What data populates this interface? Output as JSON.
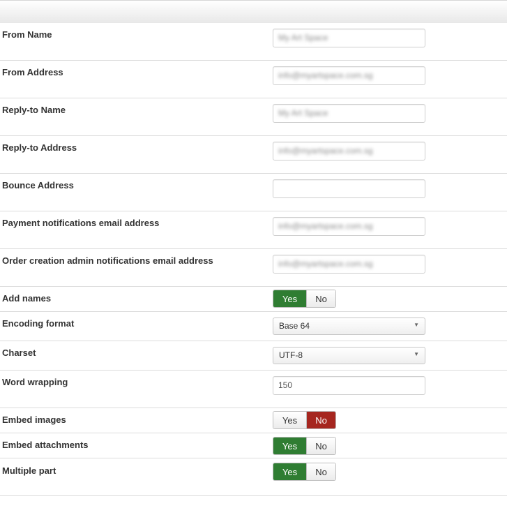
{
  "fields": {
    "from_name": {
      "label": "From Name",
      "value": "My Art Space"
    },
    "from_address": {
      "label": "From Address",
      "value": "info@myartspace.com.sg"
    },
    "replyto_name": {
      "label": "Reply-to Name",
      "value": "My Art Space"
    },
    "replyto_address": {
      "label": "Reply-to Address",
      "value": "info@myartspace.com.sg"
    },
    "bounce_address": {
      "label": "Bounce Address",
      "value": ""
    },
    "payment_notif": {
      "label": "Payment notifications email address",
      "value": "info@myartspace.com.sg"
    },
    "order_notif": {
      "label": "Order creation admin notifications email address",
      "value": "info@myartspace.com.sg"
    },
    "add_names": {
      "label": "Add names",
      "yes": "Yes",
      "no": "No",
      "selected": "Yes"
    },
    "encoding_format": {
      "label": "Encoding format",
      "value": "Base 64"
    },
    "charset": {
      "label": "Charset",
      "value": "UTF-8"
    },
    "word_wrapping": {
      "label": "Word wrapping",
      "value": "150"
    },
    "embed_images": {
      "label": "Embed images",
      "yes": "Yes",
      "no": "No",
      "selected": "No"
    },
    "embed_attachments": {
      "label": "Embed attachments",
      "yes": "Yes",
      "no": "No",
      "selected": "Yes"
    },
    "multiple_part": {
      "label": "Multiple part",
      "yes": "Yes",
      "no": "No",
      "selected": "Yes"
    }
  },
  "colors": {
    "yes_active": "#2f7d32",
    "no_active": "#a6261f"
  }
}
